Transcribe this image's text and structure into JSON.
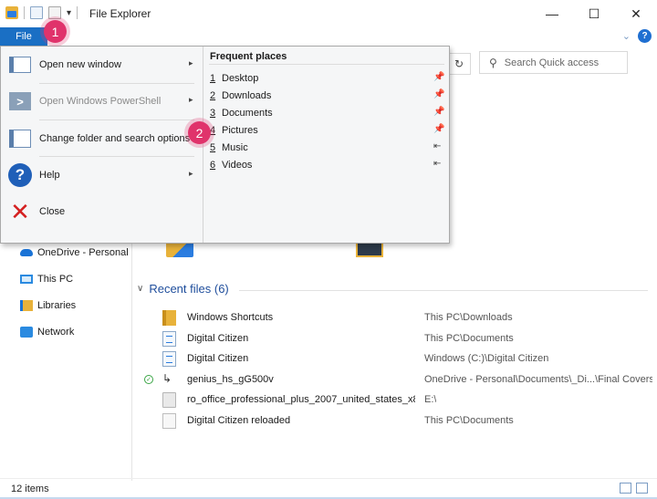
{
  "window": {
    "title": "File Explorer",
    "controls": {
      "minimize": "—",
      "maximize": "☐",
      "close": "✕"
    }
  },
  "ribbon": {
    "file_tab": "File",
    "collapse": "⌄",
    "help": "?"
  },
  "address": {
    "refresh": "↻",
    "search_placeholder": "Search Quick access"
  },
  "file_menu": {
    "items": [
      {
        "label": "Open new window",
        "icon": "new-window-icon",
        "has_submenu": true,
        "enabled": true
      },
      {
        "label": "Open Windows PowerShell",
        "icon": "powershell-icon",
        "has_submenu": true,
        "enabled": false
      },
      {
        "label": "Change folder and search options",
        "icon": "folder-options-icon",
        "has_submenu": false,
        "enabled": true
      },
      {
        "label": "Help",
        "icon": "help-icon",
        "has_submenu": true,
        "enabled": true
      },
      {
        "label": "Close",
        "icon": "close-icon",
        "has_submenu": false,
        "enabled": true
      }
    ],
    "arrow": "▸",
    "frequent": {
      "title": "Frequent places",
      "items": [
        {
          "num": "1",
          "label": "Desktop",
          "pin": "📌"
        },
        {
          "num": "2",
          "label": "Downloads",
          "pin": "📌"
        },
        {
          "num": "3",
          "label": "Documents",
          "pin": "📌"
        },
        {
          "num": "4",
          "label": "Pictures",
          "pin": "📌"
        },
        {
          "num": "5",
          "label": "Music",
          "pin": "⇤"
        },
        {
          "num": "6",
          "label": "Videos",
          "pin": "⇤"
        }
      ]
    }
  },
  "nav": {
    "items": [
      {
        "label": "OneDrive - Personal",
        "icon": "onedrive-icon"
      },
      {
        "label": "This PC",
        "icon": "this-pc-icon"
      },
      {
        "label": "Libraries",
        "icon": "libraries-icon"
      },
      {
        "label": "Network",
        "icon": "network-icon"
      }
    ]
  },
  "recent": {
    "heading": "Recent files (6)",
    "chevron": "∨",
    "files": [
      {
        "name": "Windows Shortcuts",
        "location": "This PC\\Downloads",
        "icon": "zip-folder-icon",
        "synced": false
      },
      {
        "name": "Digital Citizen",
        "location": "This PC\\Documents",
        "icon": "document-icon",
        "synced": false
      },
      {
        "name": "Digital Citizen",
        "location": "Windows (C:)\\Digital Citizen",
        "icon": "document-icon",
        "synced": false
      },
      {
        "name": "genius_hs_gG500v",
        "location": "OneDrive - Personal\\Documents\\_Di...\\Final Covers",
        "icon": "shortcut-icon",
        "synced": true
      },
      {
        "name": "ro_office_professional_plus_2007_united_states_x8...",
        "location": "E:\\",
        "icon": "disc-image-icon",
        "synced": false
      },
      {
        "name": "Digital Citizen reloaded",
        "location": "This PC\\Documents",
        "icon": "text-file-icon",
        "synced": false
      }
    ],
    "sync_mark": "✓"
  },
  "status": {
    "count": "12 items"
  },
  "badges": [
    "1",
    "2"
  ]
}
